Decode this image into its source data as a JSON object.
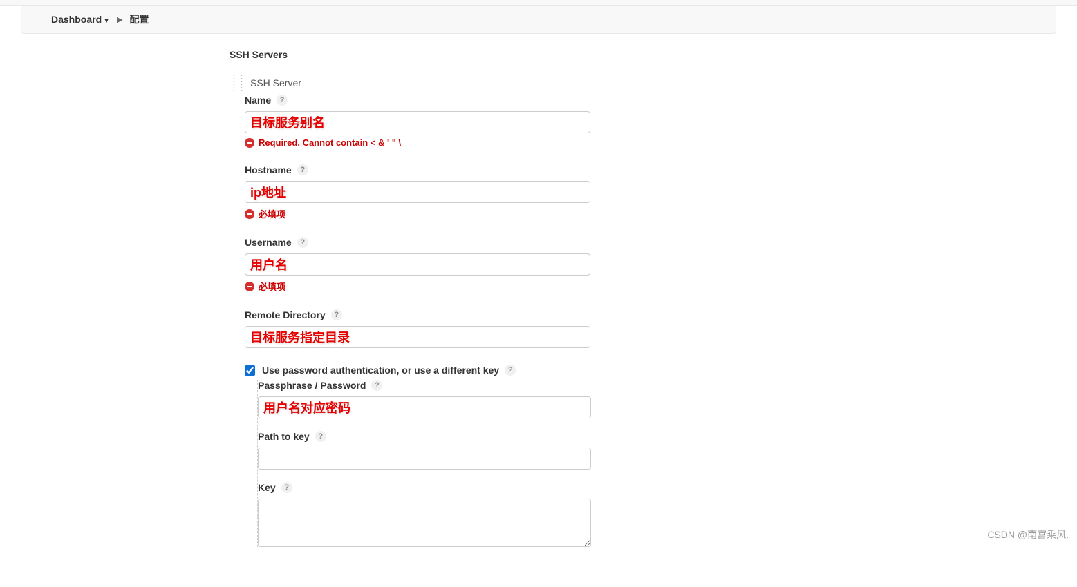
{
  "breadcrumb": {
    "root": "Dashboard",
    "current": "配置"
  },
  "section": {
    "title": "SSH Servers",
    "server_label": "SSH Server"
  },
  "fields": {
    "name": {
      "label": "Name",
      "value": "",
      "annotation": "目标服务别名",
      "error": "Required. Cannot contain < & ' \" \\"
    },
    "hostname": {
      "label": "Hostname",
      "value": "",
      "annotation": "ip地址",
      "error": "必填项"
    },
    "username": {
      "label": "Username",
      "value": "",
      "annotation": "用户名",
      "error": "必填项"
    },
    "remote_dir": {
      "label": "Remote Directory",
      "value": "",
      "annotation": "目标服务指定目录"
    },
    "use_password": {
      "label": "Use password authentication, or use a different key",
      "checked": true
    },
    "passphrase": {
      "label": "Passphrase / Password",
      "value": "",
      "annotation": "用户名对应密码"
    },
    "path_to_key": {
      "label": "Path to key",
      "value": ""
    },
    "key": {
      "label": "Key",
      "value": ""
    }
  },
  "watermark": "CSDN @南宫乘风."
}
